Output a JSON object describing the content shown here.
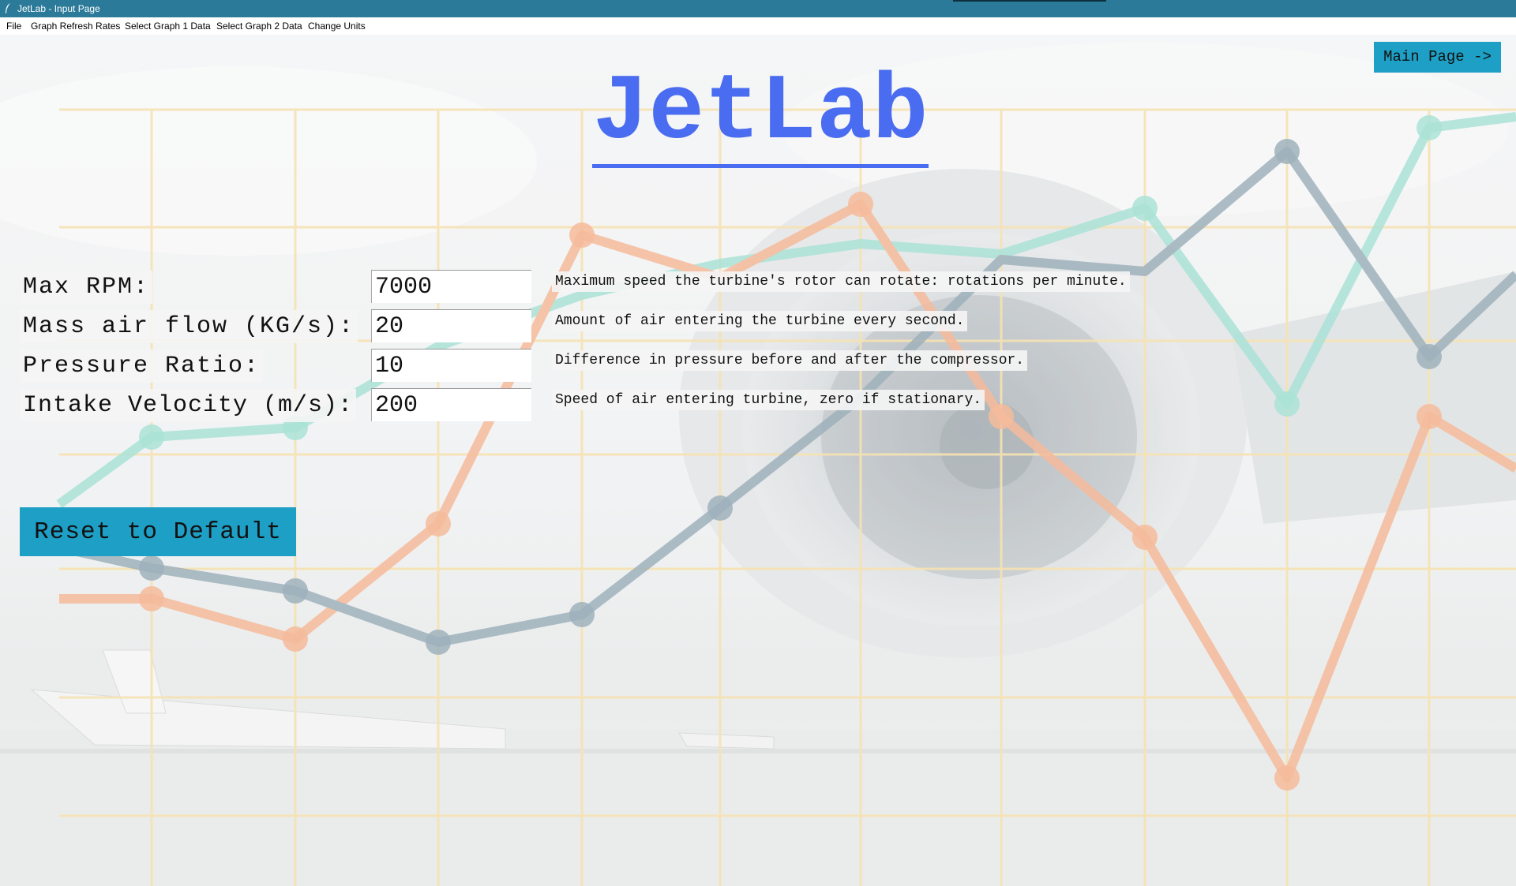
{
  "window": {
    "title": "JetLab - Input Page"
  },
  "menu": [
    "File",
    "Graph Refresh Rates",
    "Select Graph 1 Data",
    "Select Graph 2 Data",
    "Change Units"
  ],
  "header": {
    "logo": "JetLab",
    "main_page_button": "Main Page ->"
  },
  "inputs": [
    {
      "label": "Max RPM:",
      "value": "7000",
      "description": "Maximum speed the turbine's rotor can rotate: rotations per minute."
    },
    {
      "label": "Mass air flow (KG/s):",
      "value": "20",
      "description": "Amount of air entering the turbine every second."
    },
    {
      "label": "Pressure Ratio:",
      "value": "10",
      "description": "Difference in pressure before and after the compressor."
    },
    {
      "label": "Intake Velocity (m/s):",
      "value": "200",
      "description": "Speed of air entering turbine, zero if stationary."
    }
  ],
  "reset_button": "Reset to Default",
  "colors": {
    "titlebar": "#2b7a99",
    "button": "#1e9fc5",
    "logo": "#4a6cf0",
    "grid": "#f3d99a",
    "series_teal": "#8fd9c9",
    "series_orange": "#f2a47a",
    "series_slate": "#7f98a6"
  },
  "icons": [
    "feather-app-icon"
  ]
}
